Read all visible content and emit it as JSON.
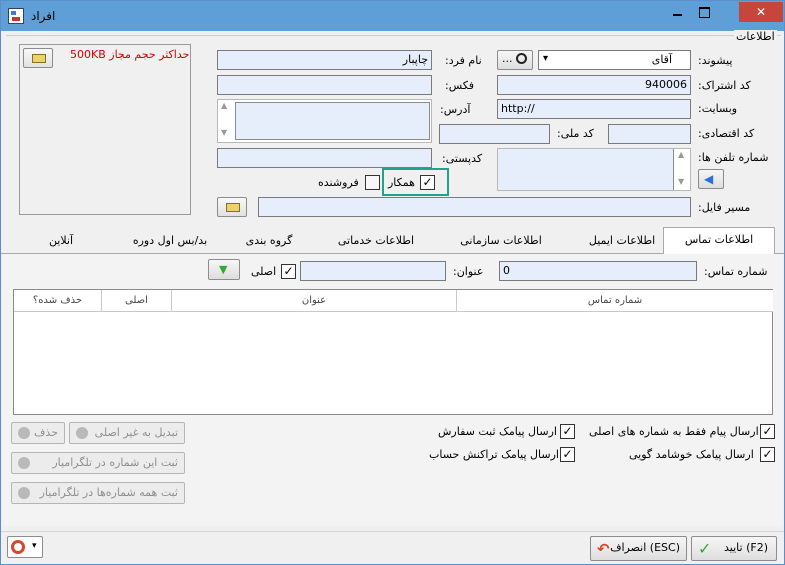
{
  "window": {
    "title": "افراد",
    "close_glyph": "✕"
  },
  "info_group": {
    "title": "اطلاعات"
  },
  "photo": {
    "max_size_note": "حداکثر حجم مجاز 500KB"
  },
  "fields": {
    "prefix_label": "پیشوند:",
    "prefix_value": "آقای",
    "name_label": "نام فرد:",
    "name_value": "چاپبار",
    "name_lookup_label": "...",
    "subscription_label": "کد اشتراک:",
    "subscription_value": "940006",
    "fax_label": "فکس:",
    "fax_value": "",
    "website_label": "وبسایت:",
    "website_value": "http://",
    "address_label": "آدرس:",
    "address_value": "",
    "economic_code_label": "کد اقتصادی:",
    "economic_code_value": "",
    "national_code_label": "کد ملی:",
    "national_code_value": "",
    "phones_label": "شماره تلفن ها:",
    "phones_value": "",
    "postal_code_label": "کدپستی:",
    "postal_code_value": "",
    "partner_label": "همکار",
    "partner_checked": true,
    "seller_label": "فروشنده",
    "seller_checked": false,
    "file_path_label": "مسیر فایل:",
    "file_path_value": ""
  },
  "tabs": [
    {
      "label": "اطلاعات تماس",
      "active": true
    },
    {
      "label": "اطلاعات ایمیل",
      "active": false
    },
    {
      "label": "اطلاعات سازمانی",
      "active": false
    },
    {
      "label": "اطلاعات خدماتی",
      "active": false
    },
    {
      "label": "گروه بندی",
      "active": false
    },
    {
      "label": "بد/بس اول دوره",
      "active": false
    },
    {
      "label": "آنلاین",
      "active": false
    }
  ],
  "contact": {
    "number_label": "شماره تماس:",
    "number_value": "0",
    "title_label": "عنوان:",
    "title_value": "",
    "main_label": "اصلی",
    "main_checked": true
  },
  "table": {
    "columns": [
      "شماره تماس",
      "عنوان",
      "اصلی",
      "حذف شده؟"
    ],
    "rows": []
  },
  "options": {
    "send_main_only": "ارسال پیام فقط به شماره های اصلی",
    "send_order_sms": "ارسال پیامک ثبت سفارش",
    "send_welcome_sms": "ارسال پیامک خوشامد گویی",
    "send_transaction_sms": "ارسال پیامک تراکنش حساب"
  },
  "side_buttons": {
    "delete": "حذف",
    "convert_non_main": "تبدیل به غیر اصلی",
    "register_telegram": "ثبت این شماره در تلگرامیار",
    "register_all_telegram": "ثبت همه شماره‌ها در تلگرامیار"
  },
  "footer": {
    "ok_label": "(F2) تایید",
    "cancel_label": "(ESC) انصراف"
  },
  "colors": {
    "titlebar": "#5f9fd8",
    "input_bg": "#e6eefc",
    "highlight": "#1fa38a",
    "note_red": "#d40000",
    "ok_green": "#36a836",
    "cancel_arrow": "#d9452f",
    "nav_arrow": "#2f6fd8"
  }
}
